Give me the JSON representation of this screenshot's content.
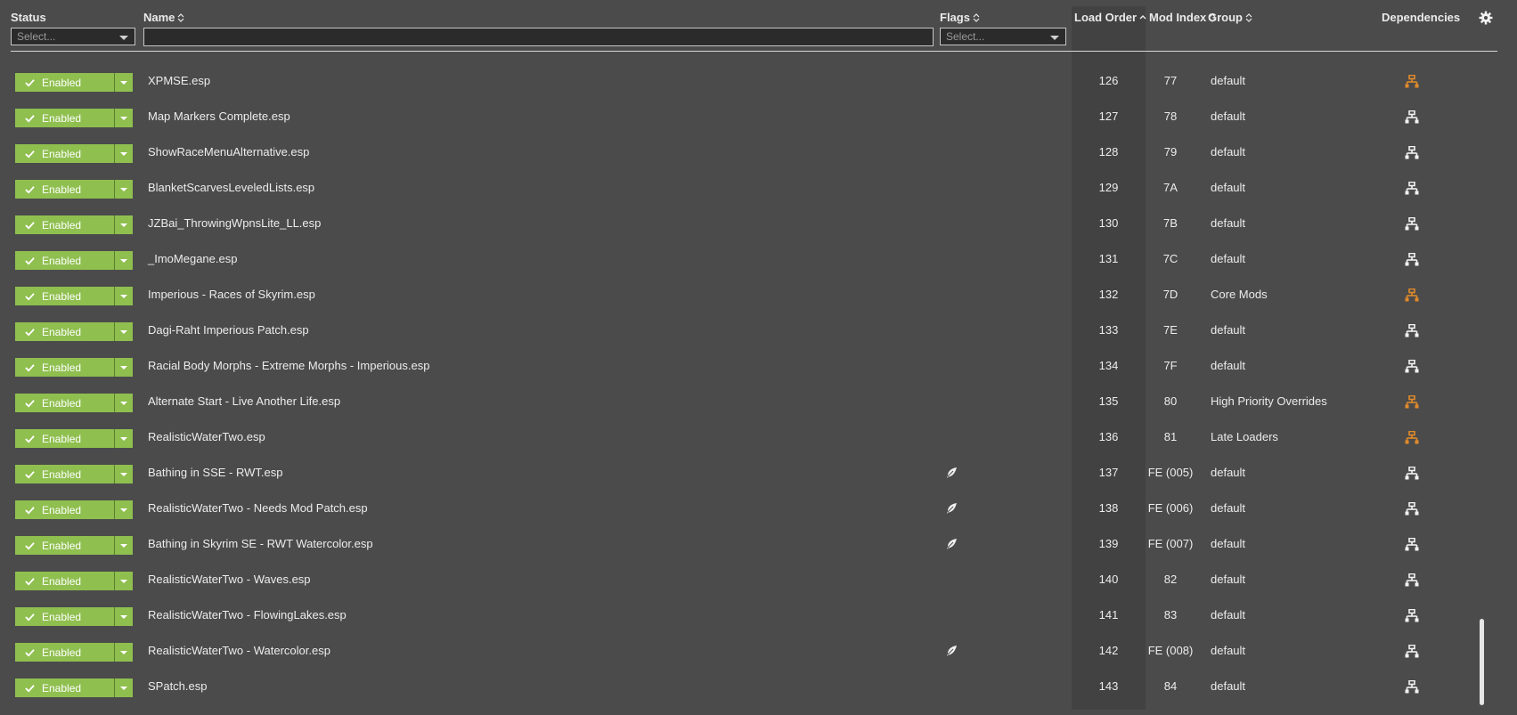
{
  "header": {
    "status": "Status",
    "name": "Name",
    "flags": "Flags",
    "load_order": "Load Order",
    "mod_index": "Mod Index",
    "group": "Group",
    "dependencies": "Dependencies",
    "status_filter_placeholder": "Select...",
    "flags_filter_placeholder": "Select...",
    "name_filter_value": ""
  },
  "colors": {
    "enabled": "#8fbf4f",
    "dep_warning": "#e08a2a",
    "dep_normal": "#f2f2f2"
  },
  "rows": [
    {
      "status": "Enabled",
      "name": "XPMSE.esp",
      "flag": false,
      "load_order": "126",
      "mod_index": "77",
      "group": "default",
      "dep": "warning"
    },
    {
      "status": "Enabled",
      "name": "Map Markers Complete.esp",
      "flag": false,
      "load_order": "127",
      "mod_index": "78",
      "group": "default",
      "dep": "normal"
    },
    {
      "status": "Enabled",
      "name": "ShowRaceMenuAlternative.esp",
      "flag": false,
      "load_order": "128",
      "mod_index": "79",
      "group": "default",
      "dep": "normal"
    },
    {
      "status": "Enabled",
      "name": "BlanketScarvesLeveledLists.esp",
      "flag": false,
      "load_order": "129",
      "mod_index": "7A",
      "group": "default",
      "dep": "normal"
    },
    {
      "status": "Enabled",
      "name": "JZBai_ThrowingWpnsLite_LL.esp",
      "flag": false,
      "load_order": "130",
      "mod_index": "7B",
      "group": "default",
      "dep": "normal"
    },
    {
      "status": "Enabled",
      "name": "_ImoMegane.esp",
      "flag": false,
      "load_order": "131",
      "mod_index": "7C",
      "group": "default",
      "dep": "normal"
    },
    {
      "status": "Enabled",
      "name": "Imperious - Races of Skyrim.esp",
      "flag": false,
      "load_order": "132",
      "mod_index": "7D",
      "group": "Core Mods",
      "dep": "warning"
    },
    {
      "status": "Enabled",
      "name": "Dagi-Raht Imperious Patch.esp",
      "flag": false,
      "load_order": "133",
      "mod_index": "7E",
      "group": "default",
      "dep": "normal"
    },
    {
      "status": "Enabled",
      "name": "Racial Body Morphs - Extreme Morphs - Imperious.esp",
      "flag": false,
      "load_order": "134",
      "mod_index": "7F",
      "group": "default",
      "dep": "normal"
    },
    {
      "status": "Enabled",
      "name": "Alternate Start - Live Another Life.esp",
      "flag": false,
      "load_order": "135",
      "mod_index": "80",
      "group": "High Priority Overrides",
      "dep": "warning"
    },
    {
      "status": "Enabled",
      "name": "RealisticWaterTwo.esp",
      "flag": false,
      "load_order": "136",
      "mod_index": "81",
      "group": "Late Loaders",
      "dep": "warning"
    },
    {
      "status": "Enabled",
      "name": "Bathing in SSE - RWT.esp",
      "flag": true,
      "load_order": "137",
      "mod_index": "FE (005)",
      "group": "default",
      "dep": "normal"
    },
    {
      "status": "Enabled",
      "name": "RealisticWaterTwo - Needs Mod Patch.esp",
      "flag": true,
      "load_order": "138",
      "mod_index": "FE (006)",
      "group": "default",
      "dep": "normal"
    },
    {
      "status": "Enabled",
      "name": "Bathing in Skyrim SE - RWT Watercolor.esp",
      "flag": true,
      "load_order": "139",
      "mod_index": "FE (007)",
      "group": "default",
      "dep": "normal"
    },
    {
      "status": "Enabled",
      "name": "RealisticWaterTwo - Waves.esp",
      "flag": false,
      "load_order": "140",
      "mod_index": "82",
      "group": "default",
      "dep": "normal"
    },
    {
      "status": "Enabled",
      "name": "RealisticWaterTwo - FlowingLakes.esp",
      "flag": false,
      "load_order": "141",
      "mod_index": "83",
      "group": "default",
      "dep": "normal"
    },
    {
      "status": "Enabled",
      "name": "RealisticWaterTwo - Watercolor.esp",
      "flag": true,
      "load_order": "142",
      "mod_index": "FE (008)",
      "group": "default",
      "dep": "normal"
    },
    {
      "status": "Enabled",
      "name": "SPatch.esp",
      "flag": false,
      "load_order": "143",
      "mod_index": "84",
      "group": "default",
      "dep": "normal"
    }
  ]
}
